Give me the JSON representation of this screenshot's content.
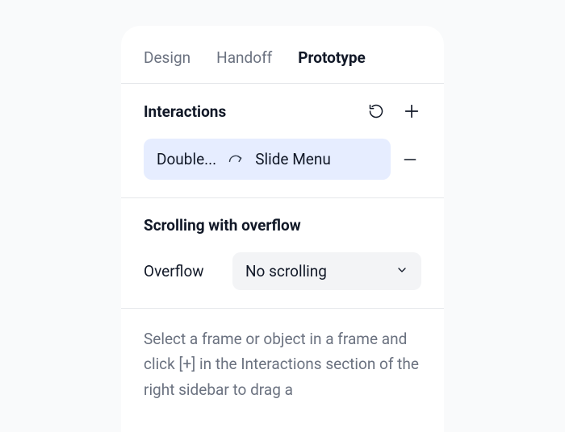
{
  "tabs": {
    "design": "Design",
    "handoff": "Handoff",
    "prototype": "Prototype"
  },
  "interactions": {
    "title": "Interactions",
    "item": {
      "trigger": "Double...",
      "target": "Slide Menu"
    }
  },
  "scrolling": {
    "title": "Scrolling with overflow",
    "label": "Overflow",
    "selected": "No scrolling"
  },
  "help": {
    "text": "Select a frame or object in a frame and click [+] in the Interactions section of the right sidebar to drag a"
  }
}
